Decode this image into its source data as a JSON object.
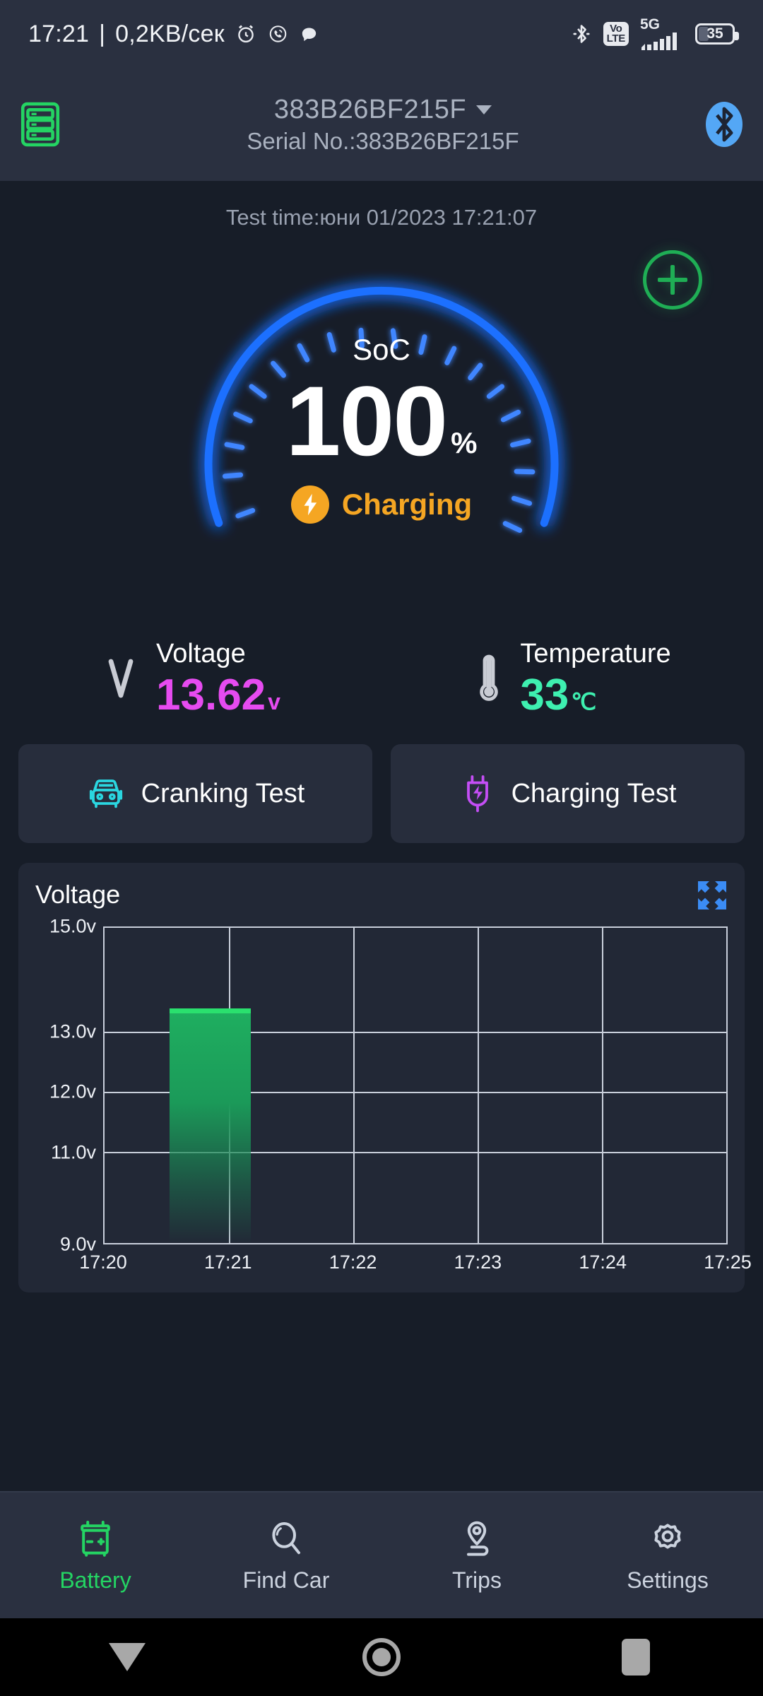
{
  "status_bar": {
    "clock": "17:21",
    "separator": "|",
    "data_rate": "0,2KB/сек",
    "icons_left": [
      "alarm-clock-icon",
      "viber-icon",
      "message-icon"
    ],
    "bluetooth": "bluetooth-icon",
    "volte_top": "Vo",
    "volte_bottom": "LTE",
    "network_gen": "5G",
    "signal": "signal-bars-icon",
    "battery_percent": "35"
  },
  "app_bar": {
    "records_icon": "records-list-icon",
    "device_name": "383B26BF215F",
    "dropdown_icon": "chevron-down-icon",
    "serial_label": "Serial No.:383B26BF215F",
    "bluetooth_icon": "bluetooth-connected-icon"
  },
  "main": {
    "test_time": "Test time:юни 01/2023 17:21:07",
    "add_button": "plus-circle-button"
  },
  "gauge": {
    "label": "SoC",
    "value": "100",
    "unit": "%",
    "status_text": "Charging",
    "status_icon": "lightning-bolt-icon",
    "arc_color": "#1f6fff",
    "status_color": "#f5a623",
    "min": 0,
    "max": 100,
    "current": 100
  },
  "metrics": [
    {
      "icon": "voltage-icon",
      "label": "Voltage",
      "value": "13.62",
      "unit": "v",
      "color": "#e64bf0"
    },
    {
      "icon": "thermometer-icon",
      "label": "Temperature",
      "value": "33",
      "unit": "℃",
      "color": "#3ef0b0"
    }
  ],
  "tests": [
    {
      "icon": "car-front-icon",
      "label": "Cranking Test",
      "color": "#2ad6e0"
    },
    {
      "icon": "power-plug-icon",
      "label": "Charging Test",
      "color": "#c44ef5"
    }
  ],
  "chart_card": {
    "title": "Voltage",
    "expand_icon": "expand-fullscreen-icon",
    "expand_color": "#3b8cf5"
  },
  "chart_data": {
    "type": "area",
    "title": "Voltage",
    "xlabel": "",
    "ylabel": "",
    "ylim": [
      9.0,
      15.0
    ],
    "grid": true,
    "legend": "none",
    "line_color": "#2ae06e",
    "fill_color": "#1b9a59",
    "y_ticks": [
      "15.0v",
      "13.0v",
      "12.0v",
      "11.0v",
      "9.0v"
    ],
    "y_tick_values": [
      15.0,
      13.0,
      12.0,
      11.0,
      9.0
    ],
    "y_tick_positions_pct": [
      0,
      33,
      52,
      71,
      100
    ],
    "x_ticks": [
      "17:20",
      "17:21",
      "17:22",
      "17:23",
      "17:24",
      "17:25"
    ],
    "x_tick_positions_pct": [
      0,
      20,
      40,
      60,
      80,
      100
    ],
    "series": [
      {
        "name": "Voltage",
        "x": [
          "17:20:20",
          "17:20:30",
          "17:20:40",
          "17:20:50",
          "17:21:00",
          "17:21:07"
        ],
        "values": [
          13.62,
          13.63,
          13.62,
          13.64,
          13.62,
          13.62
        ]
      }
    ],
    "data_start_pct": 10.5,
    "data_end_pct": 23.5,
    "data_top_pct": 25.5
  },
  "bottom_nav": [
    {
      "icon": "battery-icon",
      "label": "Battery",
      "active": true
    },
    {
      "icon": "search-car-icon",
      "label": "Find Car",
      "active": false
    },
    {
      "icon": "location-pin-icon",
      "label": "Trips",
      "active": false
    },
    {
      "icon": "gear-icon",
      "label": "Settings",
      "active": false
    }
  ],
  "android_nav": [
    {
      "icon": "back-triangle-icon"
    },
    {
      "icon": "home-circle-icon"
    },
    {
      "icon": "recents-square-icon"
    }
  ]
}
